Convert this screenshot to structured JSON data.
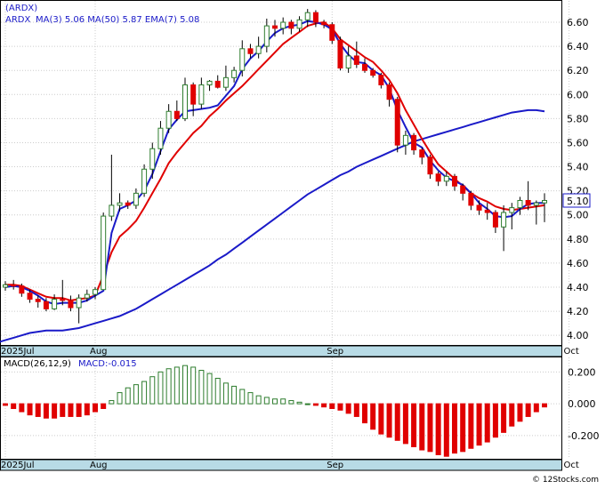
{
  "chart_data": [
    {
      "type": "candlestick",
      "ticker": "(ARDX)",
      "legend": [
        {
          "label": "MA(3)",
          "value": "5.06",
          "color": "#1a1ac8"
        },
        {
          "label": "MA(50)",
          "value": "5.87",
          "color": "#1a1ac8"
        },
        {
          "label": "EMA(7)",
          "value": "5.08",
          "color": "#1a1ac8"
        }
      ],
      "last_price_label": "5.10",
      "y_ticks": [
        "6.60",
        "6.40",
        "6.20",
        "6.00",
        "5.80",
        "5.60",
        "5.40",
        "5.20",
        "5.00",
        "4.80",
        "4.60",
        "4.40",
        "4.20",
        "4.00"
      ],
      "y_tick_values": [
        6.6,
        6.4,
        6.2,
        6.0,
        5.8,
        5.6,
        5.4,
        5.2,
        5.0,
        4.8,
        4.6,
        4.4,
        4.2,
        4.0
      ],
      "ylim": [
        3.92,
        6.77
      ],
      "x_labels": [
        {
          "label": "2025Jul",
          "index": 0
        },
        {
          "label": "Aug",
          "index": 11
        },
        {
          "label": "Sep",
          "index": 40
        },
        {
          "label": "Oct",
          "index": 69
        }
      ],
      "ohlc": [
        [
          4.4,
          4.45,
          4.37,
          4.42
        ],
        [
          4.42,
          4.46,
          4.38,
          4.41
        ],
        [
          4.41,
          4.43,
          4.32,
          4.35
        ],
        [
          4.35,
          4.38,
          4.27,
          4.3
        ],
        [
          4.3,
          4.33,
          4.23,
          4.28
        ],
        [
          4.28,
          4.31,
          4.2,
          4.22
        ],
        [
          4.22,
          4.34,
          4.21,
          4.3
        ],
        [
          4.3,
          4.46,
          4.25,
          4.29
        ],
        [
          4.29,
          4.33,
          4.2,
          4.23
        ],
        [
          4.23,
          4.34,
          4.1,
          4.31
        ],
        [
          4.31,
          4.38,
          4.28,
          4.34
        ],
        [
          4.34,
          4.4,
          4.3,
          4.38
        ],
        [
          4.38,
          5.02,
          4.9,
          4.99
        ],
        [
          4.99,
          5.5,
          4.95,
          5.08
        ],
        [
          5.08,
          5.18,
          5.03,
          5.1
        ],
        [
          5.1,
          5.12,
          5.05,
          5.08
        ],
        [
          5.08,
          5.22,
          5.05,
          5.18
        ],
        [
          5.18,
          5.42,
          5.15,
          5.38
        ],
        [
          5.38,
          5.6,
          5.3,
          5.55
        ],
        [
          5.55,
          5.78,
          5.5,
          5.72
        ],
        [
          5.72,
          5.92,
          5.68,
          5.86
        ],
        [
          5.86,
          5.95,
          5.78,
          5.8
        ],
        [
          5.8,
          6.14,
          5.78,
          6.08
        ],
        [
          6.08,
          6.1,
          5.82,
          5.92
        ],
        [
          5.92,
          6.14,
          5.88,
          6.08
        ],
        [
          6.08,
          6.12,
          6.03,
          6.11
        ],
        [
          6.11,
          6.16,
          6.05,
          6.06
        ],
        [
          6.06,
          6.24,
          6.03,
          6.14
        ],
        [
          6.14,
          6.23,
          6.1,
          6.2
        ],
        [
          6.2,
          6.45,
          6.15,
          6.38
        ],
        [
          6.38,
          6.42,
          6.3,
          6.34
        ],
        [
          6.34,
          6.48,
          6.3,
          6.4
        ],
        [
          6.4,
          6.63,
          6.35,
          6.57
        ],
        [
          6.57,
          6.62,
          6.48,
          6.55
        ],
        [
          6.55,
          6.64,
          6.5,
          6.6
        ],
        [
          6.6,
          6.62,
          6.5,
          6.55
        ],
        [
          6.55,
          6.65,
          6.52,
          6.62
        ],
        [
          6.62,
          6.71,
          6.56,
          6.68
        ],
        [
          6.68,
          6.7,
          6.56,
          6.6
        ],
        [
          6.6,
          6.62,
          6.55,
          6.58
        ],
        [
          6.58,
          6.6,
          6.42,
          6.45
        ],
        [
          6.45,
          6.48,
          6.2,
          6.22
        ],
        [
          6.22,
          6.4,
          6.18,
          6.32
        ],
        [
          6.32,
          6.44,
          6.22,
          6.25
        ],
        [
          6.25,
          6.3,
          6.18,
          6.2
        ],
        [
          6.2,
          6.22,
          6.14,
          6.16
        ],
        [
          6.16,
          6.18,
          6.05,
          6.08
        ],
        [
          6.08,
          6.1,
          5.9,
          5.96
        ],
        [
          5.96,
          5.98,
          5.52,
          5.58
        ],
        [
          5.58,
          5.7,
          5.5,
          5.66
        ],
        [
          5.66,
          5.68,
          5.5,
          5.54
        ],
        [
          5.54,
          5.56,
          5.42,
          5.48
        ],
        [
          5.48,
          5.5,
          5.3,
          5.34
        ],
        [
          5.34,
          5.36,
          5.24,
          5.28
        ],
        [
          5.28,
          5.36,
          5.24,
          5.32
        ],
        [
          5.32,
          5.34,
          5.2,
          5.24
        ],
        [
          5.24,
          5.26,
          5.12,
          5.18
        ],
        [
          5.18,
          5.2,
          5.04,
          5.08
        ],
        [
          5.08,
          5.12,
          5.0,
          5.04
        ],
        [
          5.04,
          5.1,
          4.96,
          5.02
        ],
        [
          5.02,
          5.04,
          4.85,
          4.9
        ],
        [
          4.9,
          5.08,
          4.7,
          5.02
        ],
        [
          5.02,
          5.1,
          4.88,
          5.06
        ],
        [
          5.06,
          5.15,
          5.0,
          5.12
        ],
        [
          5.12,
          5.28,
          5.04,
          5.08
        ],
        [
          5.08,
          5.12,
          4.92,
          5.1
        ],
        [
          5.1,
          5.18,
          4.94,
          5.12
        ]
      ],
      "ma3": [
        4.4,
        4.41,
        4.4,
        4.37,
        4.33,
        4.28,
        4.26,
        4.27,
        4.27,
        4.27,
        4.29,
        4.33,
        4.37,
        4.85,
        5.05,
        5.08,
        5.12,
        5.2,
        5.34,
        5.53,
        5.71,
        5.79,
        5.86,
        5.87,
        5.88,
        5.89,
        5.91,
        5.99,
        6.07,
        6.21,
        6.3,
        6.36,
        6.44,
        6.51,
        6.55,
        6.57,
        6.58,
        6.61,
        6.6,
        6.58,
        6.54,
        6.42,
        6.33,
        6.27,
        6.26,
        6.2,
        6.16,
        6.05,
        5.87,
        5.73,
        5.6,
        5.56,
        5.45,
        5.37,
        5.31,
        5.28,
        5.25,
        5.18,
        5.1,
        5.05,
        4.99,
        4.98,
        4.99,
        5.05,
        5.09,
        5.1,
        5.1
      ],
      "ema7": [
        4.42,
        4.42,
        4.41,
        4.38,
        4.35,
        4.32,
        4.31,
        4.31,
        4.29,
        4.3,
        4.31,
        4.33,
        4.5,
        4.69,
        4.82,
        4.88,
        4.95,
        5.06,
        5.18,
        5.3,
        5.43,
        5.52,
        5.6,
        5.68,
        5.74,
        5.82,
        5.88,
        5.95,
        6.01,
        6.07,
        6.14,
        6.21,
        6.28,
        6.35,
        6.42,
        6.47,
        6.52,
        6.57,
        6.59,
        6.6,
        6.55,
        6.46,
        6.41,
        6.36,
        6.31,
        6.27,
        6.2,
        6.12,
        6.01,
        5.87,
        5.75,
        5.63,
        5.52,
        5.42,
        5.36,
        5.3,
        5.24,
        5.18,
        5.14,
        5.11,
        5.07,
        5.05,
        5.04,
        5.05,
        5.06,
        5.07,
        5.08
      ],
      "ma50": [
        3.92,
        3.94,
        3.96,
        3.98,
        4.0,
        4.02,
        4.03,
        4.04,
        4.04,
        4.04,
        4.05,
        4.06,
        4.08,
        4.1,
        4.12,
        4.14,
        4.16,
        4.19,
        4.22,
        4.26,
        4.3,
        4.34,
        4.38,
        4.42,
        4.46,
        4.5,
        4.54,
        4.58,
        4.63,
        4.67,
        4.72,
        4.77,
        4.82,
        4.87,
        4.92,
        4.97,
        5.02,
        5.07,
        5.12,
        5.17,
        5.21,
        5.25,
        5.29,
        5.33,
        5.36,
        5.4,
        5.43,
        5.46,
        5.49,
        5.52,
        5.55,
        5.58,
        5.61,
        5.63,
        5.65,
        5.67,
        5.69,
        5.71,
        5.73,
        5.75,
        5.77,
        5.79,
        5.81,
        5.83,
        5.85,
        5.86,
        5.87,
        5.87,
        5.86
      ]
    },
    {
      "type": "bar",
      "title": "MACD(26,12,9)",
      "value_label": "MACD:-0.015",
      "y_ticks": [
        "0.200",
        "0.000",
        "-0.200"
      ],
      "y_tick_values": [
        0.2,
        0.0,
        -0.2
      ],
      "ylim": [
        -0.34,
        0.28
      ],
      "x_labels": [
        {
          "label": "2025Jul",
          "index": 0
        },
        {
          "label": "Aug",
          "index": 11
        },
        {
          "label": "Sep",
          "index": 40
        },
        {
          "label": "Oct",
          "index": 69
        }
      ],
      "values": [
        -0.01,
        -0.03,
        -0.05,
        -0.07,
        -0.08,
        -0.09,
        -0.09,
        -0.08,
        -0.08,
        -0.08,
        -0.07,
        -0.05,
        -0.03,
        0.02,
        0.07,
        0.1,
        0.12,
        0.14,
        0.17,
        0.2,
        0.22,
        0.23,
        0.24,
        0.23,
        0.21,
        0.19,
        0.16,
        0.13,
        0.11,
        0.09,
        0.07,
        0.05,
        0.04,
        0.03,
        0.03,
        0.02,
        0.01,
        0.0,
        -0.01,
        -0.02,
        -0.03,
        -0.04,
        -0.06,
        -0.08,
        -0.12,
        -0.16,
        -0.19,
        -0.21,
        -0.23,
        -0.25,
        -0.27,
        -0.29,
        -0.3,
        -0.32,
        -0.33,
        -0.31,
        -0.3,
        -0.28,
        -0.26,
        -0.24,
        -0.21,
        -0.18,
        -0.14,
        -0.11,
        -0.08,
        -0.05,
        -0.02
      ],
      "colors": {
        "positive": "#2e7d2e",
        "negative": "#e00000"
      }
    }
  ],
  "watermark": "© 12Stocks.com"
}
